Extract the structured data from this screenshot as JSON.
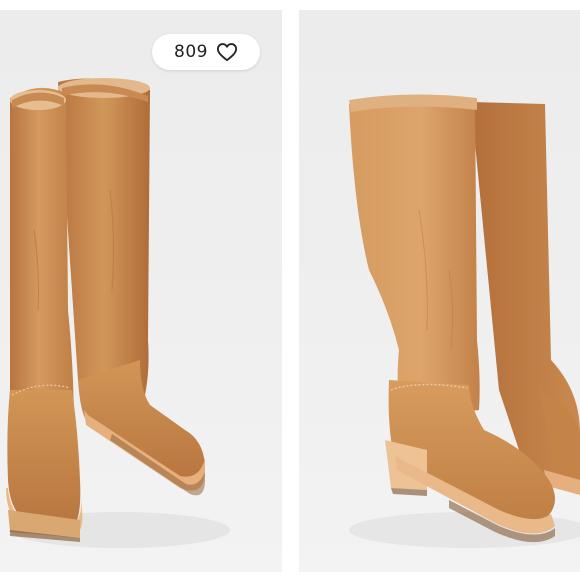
{
  "likes": {
    "count": "809",
    "icon": "heart-outline-icon"
  },
  "photos": [
    {
      "icon": "boots-photo-front-view"
    },
    {
      "icon": "boots-photo-angled-view"
    }
  ],
  "colors": {
    "leather": "#C98A4E",
    "leather_dark": "#A8673A",
    "sole": "#E9B98A",
    "background": "#EDEDED"
  }
}
